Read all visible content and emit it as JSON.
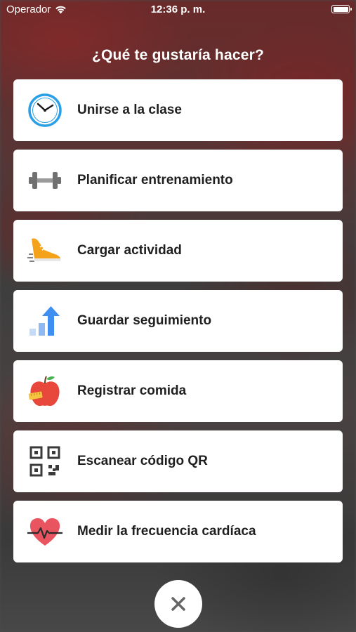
{
  "status_bar": {
    "carrier": "Operador",
    "time": "12:36 p. m."
  },
  "prompt": "¿Qué te gustaría hacer?",
  "actions": [
    {
      "label": "Unirse a la clase",
      "icon": "clock-icon"
    },
    {
      "label": "Planificar entrenamiento",
      "icon": "dumbbell-icon"
    },
    {
      "label": "Cargar actividad",
      "icon": "running-shoe-icon"
    },
    {
      "label": "Guardar seguimiento",
      "icon": "progress-bars-icon"
    },
    {
      "label": "Registrar comida",
      "icon": "apple-icon"
    },
    {
      "label": "Escanear código QR",
      "icon": "qr-code-icon"
    },
    {
      "label": "Medir la frecuencia cardíaca",
      "icon": "heart-rate-icon"
    }
  ],
  "close_icon": "close-icon",
  "colors": {
    "card": "#ffffff",
    "label": "#1f1f1f",
    "clock_blue": "#2b9fe6",
    "shoe_orange": "#f5a21b",
    "chart_blue": "#3f8ef2",
    "apple_red": "#e8473b",
    "heart_red": "#e85560"
  }
}
